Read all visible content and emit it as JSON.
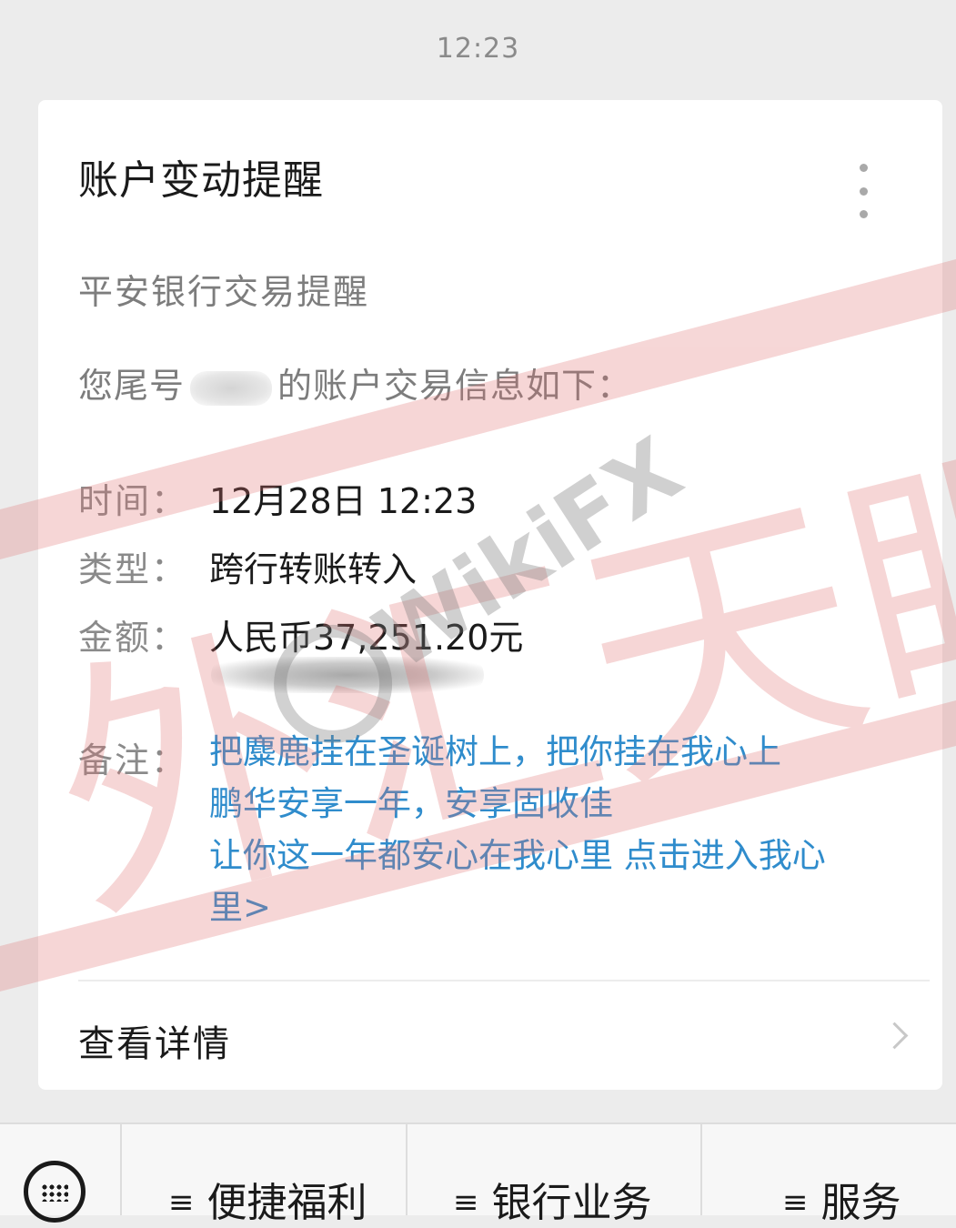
{
  "status": {
    "time": "12:23"
  },
  "message": {
    "title": "账户变动提醒",
    "subtitle": "平安银行交易提醒",
    "intro_prefix": "您尾号",
    "intro_suffix": "的账户交易信息如下：",
    "fields": [
      {
        "key": "时间：",
        "value": "12月28日 12:23"
      },
      {
        "key": "类型：",
        "value": "跨行转账转入"
      },
      {
        "key": "金额：",
        "value": "人民币37,251.20元"
      }
    ],
    "remark_key": "备注：",
    "remark_lines": [
      "把麋鹿挂在圣诞树上，把你挂在我心上",
      "鹏华安享一年，安享固收佳",
      "让你这一年都安心在我心里 点击进入我心",
      "里>"
    ],
    "link_color": "#2f8ccc",
    "details_label": "查看详情"
  },
  "watermark": {
    "brand": "WikiFX",
    "characters": "外汇天眼",
    "color": "#e07070"
  },
  "bottom_menu": {
    "keyboard_icon": "keyboard-icon",
    "items": [
      "便捷福利",
      "银行业务",
      "服务"
    ],
    "menu_glyph": "≡"
  }
}
